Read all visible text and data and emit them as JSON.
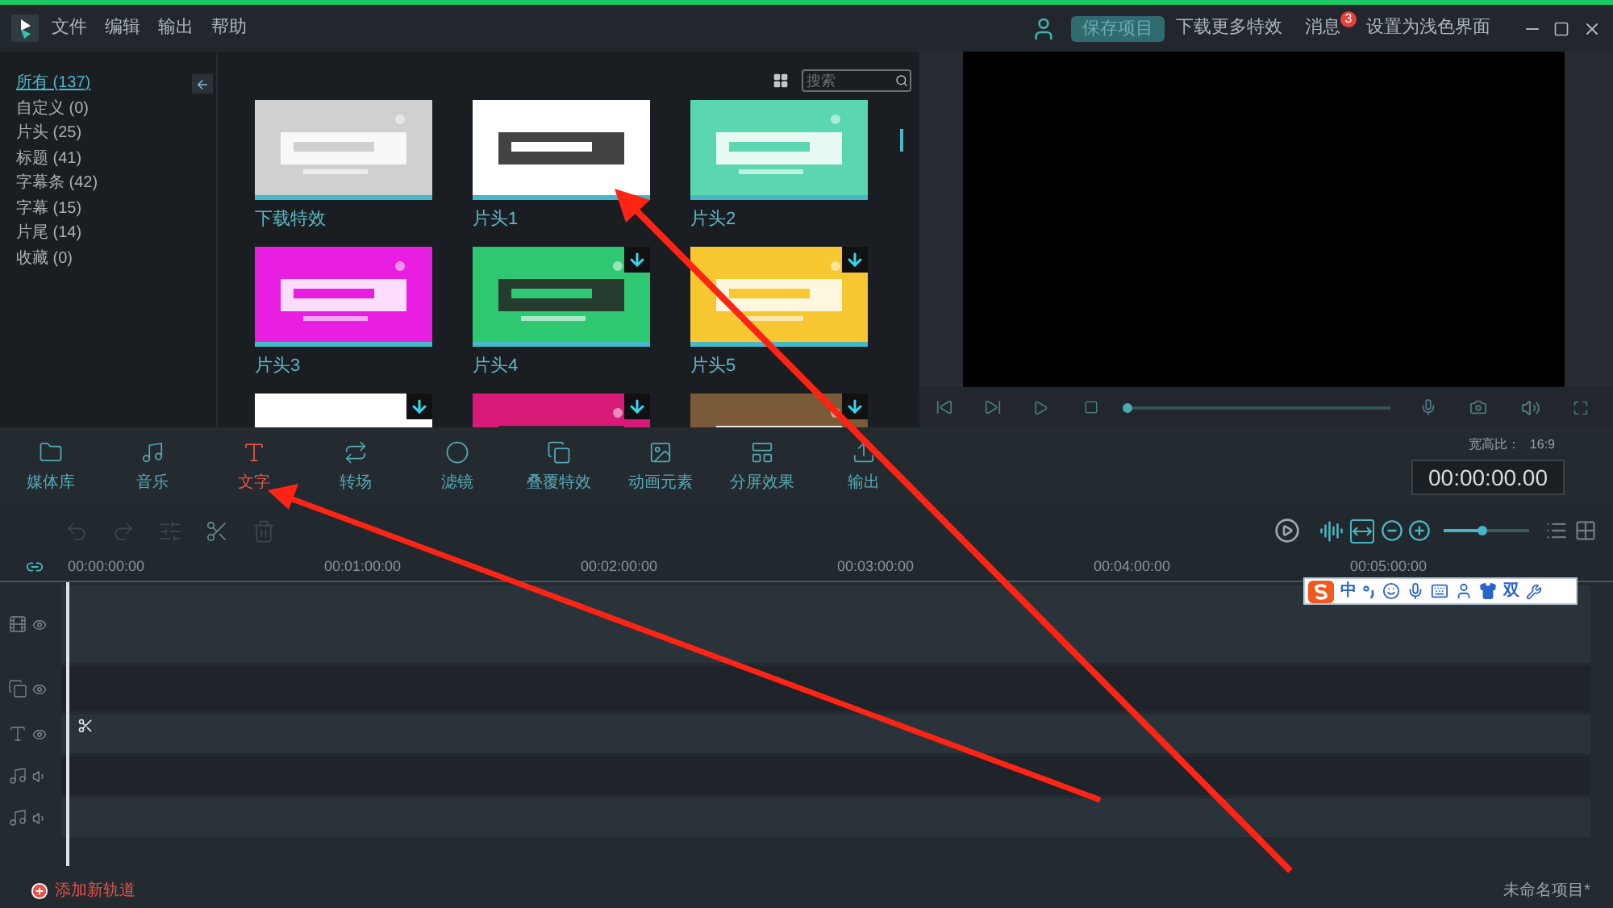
{
  "menu": [
    "文件",
    "编辑",
    "输出",
    "帮助"
  ],
  "header": {
    "save_button": "保存项目",
    "download_more": "下载更多特效",
    "messages": "消息",
    "messages_badge": "3",
    "light_theme": "设置为浅色界面"
  },
  "categories": [
    {
      "label": "所有 (137)",
      "selected": true
    },
    {
      "label": "自定义 (0)",
      "selected": false
    },
    {
      "label": "片头 (25)",
      "selected": false
    },
    {
      "label": "标题 (41)",
      "selected": false
    },
    {
      "label": "字幕条 (42)",
      "selected": false
    },
    {
      "label": "字幕 (15)",
      "selected": false
    },
    {
      "label": "片尾 (14)",
      "selected": false
    },
    {
      "label": "收藏 (0)",
      "selected": false
    }
  ],
  "search": {
    "placeholder": "搜索"
  },
  "thumbnails": [
    {
      "label": "下载特效",
      "color": "#d0d0d0",
      "downloadable": false
    },
    {
      "label": "片头1",
      "color": "#ffffff",
      "downloadable": false
    },
    {
      "label": "片头2",
      "color": "#5ad6b0",
      "downloadable": false
    },
    {
      "label": "片头3",
      "color": "#e81ee0",
      "downloadable": false
    },
    {
      "label": "片头4",
      "color": "#2ec872",
      "downloadable": true
    },
    {
      "label": "片头5",
      "color": "#f7c832",
      "downloadable": true
    },
    {
      "color": "#ffffff",
      "downloadable": true
    },
    {
      "color": "#d81a78",
      "downloadable": true
    },
    {
      "color": "#7a5a38",
      "downloadable": true
    }
  ],
  "preview": {
    "progress": {
      "level": 0
    }
  },
  "tabs": [
    {
      "label": "媒体库",
      "selected": false
    },
    {
      "label": "音乐",
      "selected": false
    },
    {
      "label": "文字",
      "selected": true
    },
    {
      "label": "转场",
      "selected": false
    },
    {
      "label": "滤镜",
      "selected": false
    },
    {
      "label": "叠覆特效",
      "selected": false
    },
    {
      "label": "动画元素",
      "selected": false
    },
    {
      "label": "分屏效果",
      "selected": false
    },
    {
      "label": "输出",
      "selected": false
    }
  ],
  "aspect_ratio": {
    "label": "宽高比：",
    "value": "16:9"
  },
  "timecode": "00:00:00.00",
  "timeline_tools": [
    {
      "disabled": true
    },
    {
      "disabled": true
    },
    {
      "disabled": true
    },
    {
      "disabled": false
    },
    {
      "disabled": true
    }
  ],
  "timeline": {
    "zoom": {
      "level": 0.45
    },
    "ruler": [
      "00:00:00:00",
      "00:01:00:00",
      "00:02:00:00",
      "00:03:00:00",
      "00:04:00:00",
      "00:05:00:00"
    ],
    "tracks": [
      {
        "kind": "video"
      },
      {
        "kind": "overlay"
      },
      {
        "kind": "text"
      },
      {
        "kind": "audio"
      },
      {
        "kind": "audio"
      }
    ]
  },
  "ime_bar": {
    "mode": "中",
    "width_mode": "双"
  },
  "footer": {
    "add_track": "添加新轨道",
    "project_name": "未命名项目*"
  }
}
